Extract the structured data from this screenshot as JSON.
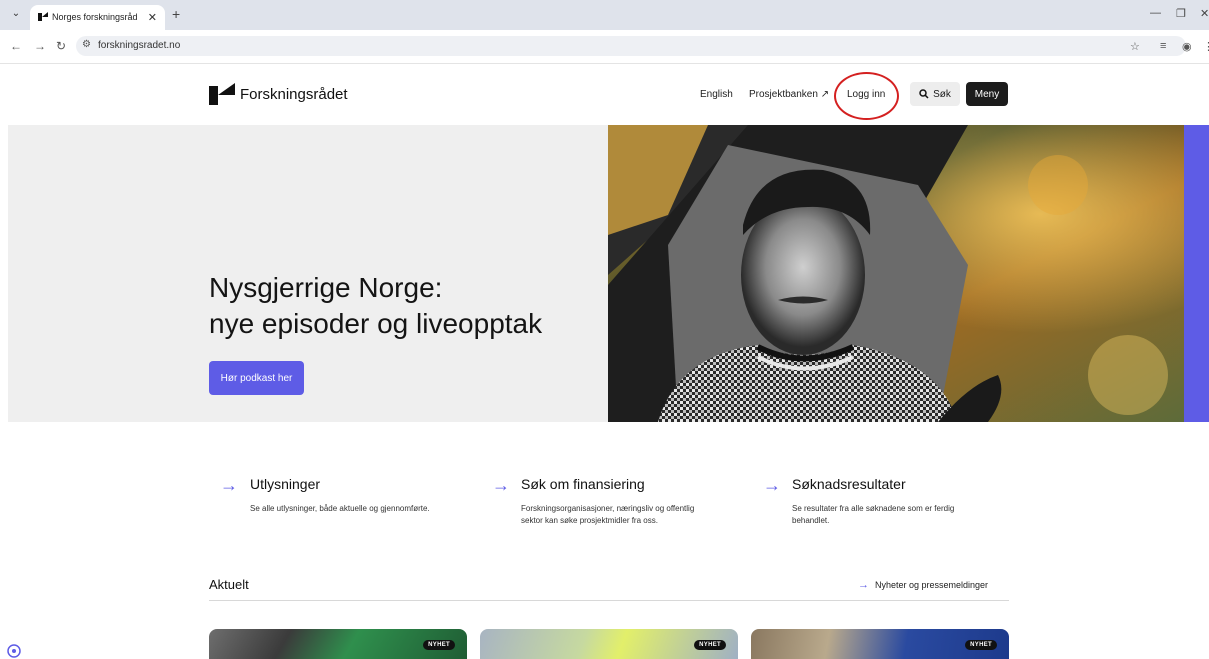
{
  "browser": {
    "tab_title": "Norges forskningsråd",
    "url": "forskningsradet.no"
  },
  "header": {
    "logo_text": "Forskningsrådet",
    "nav": {
      "english": "English",
      "prosjektbanken": "Prosjektbanken ↗",
      "login": "Logg inn",
      "search": "Søk",
      "menu": "Meny"
    }
  },
  "hero": {
    "title_line1": "Nysgjerrige Norge:",
    "title_line2": "nye episoder og liveopptak",
    "button": "Hør podkast her"
  },
  "quicklinks": [
    {
      "title": "Utlysninger",
      "desc": "Se alle utlysninger, både aktuelle og gjennomførte."
    },
    {
      "title": "Søk om finansiering",
      "desc_line1": "Forskningsorganisasjoner, næringsliv og offentlig",
      "desc_line2": "sektor kan søke prosjektmidler fra oss."
    },
    {
      "title": "Søknadsresultater",
      "desc_line1": "Se resultater fra alle søknadene som er ferdig",
      "desc_line2": "behandlet."
    }
  ],
  "news": {
    "heading": "Aktuelt",
    "link": "Nyheter og pressemeldinger",
    "cards": [
      {
        "badge": "NYHET"
      },
      {
        "badge": "NYHET"
      },
      {
        "badge": "NYHET"
      }
    ]
  },
  "colors": {
    "accent": "#5e5ce6",
    "highlight_ring": "#d42020"
  }
}
